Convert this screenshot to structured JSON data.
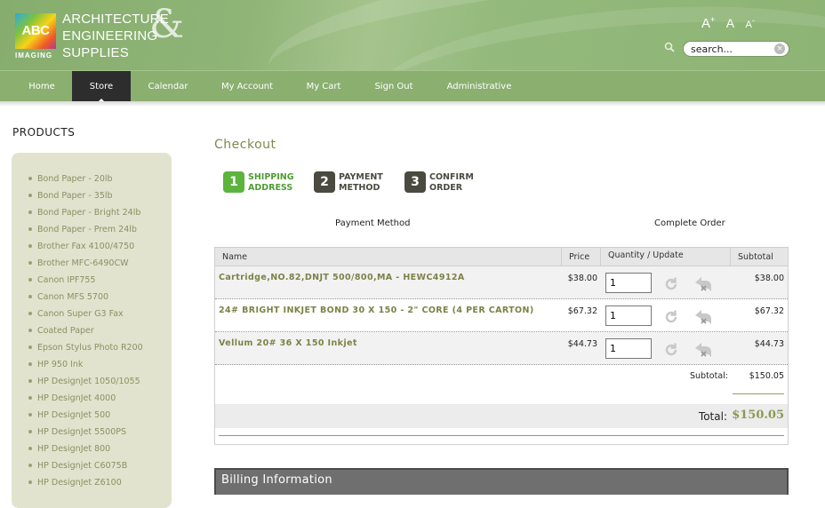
{
  "header": {
    "logo_mark": "ABC",
    "logo_sub": "IMAGING",
    "logo_lines": [
      "ARCHITECTURE",
      "ENGINEERING",
      "SUPPLIES"
    ],
    "logo_amp": "&",
    "font_controls": {
      "increase": "A",
      "normal": "A",
      "decrease": "A",
      "plus": "+",
      "minus": "-"
    },
    "search": {
      "placeholder": "search...",
      "clear": "×"
    }
  },
  "nav": {
    "items": [
      "Home",
      "Store",
      "Calendar",
      "My Account",
      "My Cart",
      "Sign Out",
      "Administrative"
    ],
    "active": "Store"
  },
  "sidebar": {
    "title": "PRODUCTS",
    "items": [
      "Bond Paper - 20lb",
      "Bond Paper - 35lb",
      "Bond Paper - Bright 24lb",
      "Bond Paper - Prem 24lb",
      "Brother Fax 4100/4750",
      "Brother MFC-6490CW",
      "Canon IPF755",
      "Canon MFS 5700",
      "Canon Super G3 Fax",
      "Coated Paper",
      "Epson Stylus Photo R200",
      "HP 950 Ink",
      "HP DesignJet 1050/1055",
      "HP DesignJet 4000",
      "HP DesignJet 500",
      "HP DesignJet 5500PS",
      "HP DesignJet 800",
      "HP Designjet C6075B",
      "HP DesignJet Z6100"
    ]
  },
  "checkout": {
    "title": "Checkout",
    "steps": [
      {
        "num": "1",
        "line1": "SHIPPING",
        "line2": "ADDRESS",
        "color": "#5cb43c",
        "text_color": "#4f9c35"
      },
      {
        "num": "2",
        "line1": "PAYMENT",
        "line2": "METHOD",
        "color": "#4a4a40",
        "text_color": "#4a4a40"
      },
      {
        "num": "3",
        "line1": "CONFIRM",
        "line2": "ORDER",
        "color": "#4a4a40",
        "text_color": "#4a4a40"
      }
    ],
    "subheads": {
      "left": "Payment Method",
      "right": "Complete Order"
    }
  },
  "cart": {
    "headers": {
      "name": "Name",
      "price": "Price",
      "qty": "Quantity / Update",
      "subtotal": "Subtotal"
    },
    "rows": [
      {
        "name": "Cartridge,NO.82,DNJT 500/800,MA - HEWC4912A",
        "price": "$38.00",
        "qty": "1",
        "subtotal": "$38.00"
      },
      {
        "name": "24# BRIGHT INKJET BOND 30 X 150 - 2\" CORE (4 PER CARTON)",
        "price": "$67.32",
        "qty": "1",
        "subtotal": "$67.32"
      },
      {
        "name": "Vellum 20# 36 X 150 Inkjet",
        "price": "$44.73",
        "qty": "1",
        "subtotal": "$44.73"
      }
    ],
    "subtotal_label": "Subtotal:",
    "subtotal_value": "$150.05",
    "total_label": "Total:",
    "total_value": "$150.05"
  },
  "billing": {
    "title": "Billing Information"
  },
  "colors": {
    "header_green": "#8db375",
    "nav_green": "#8aaf6f",
    "active_tab": "#2d2d2d",
    "product_text": "#8a9063",
    "accent_olive": "#7d8245"
  }
}
